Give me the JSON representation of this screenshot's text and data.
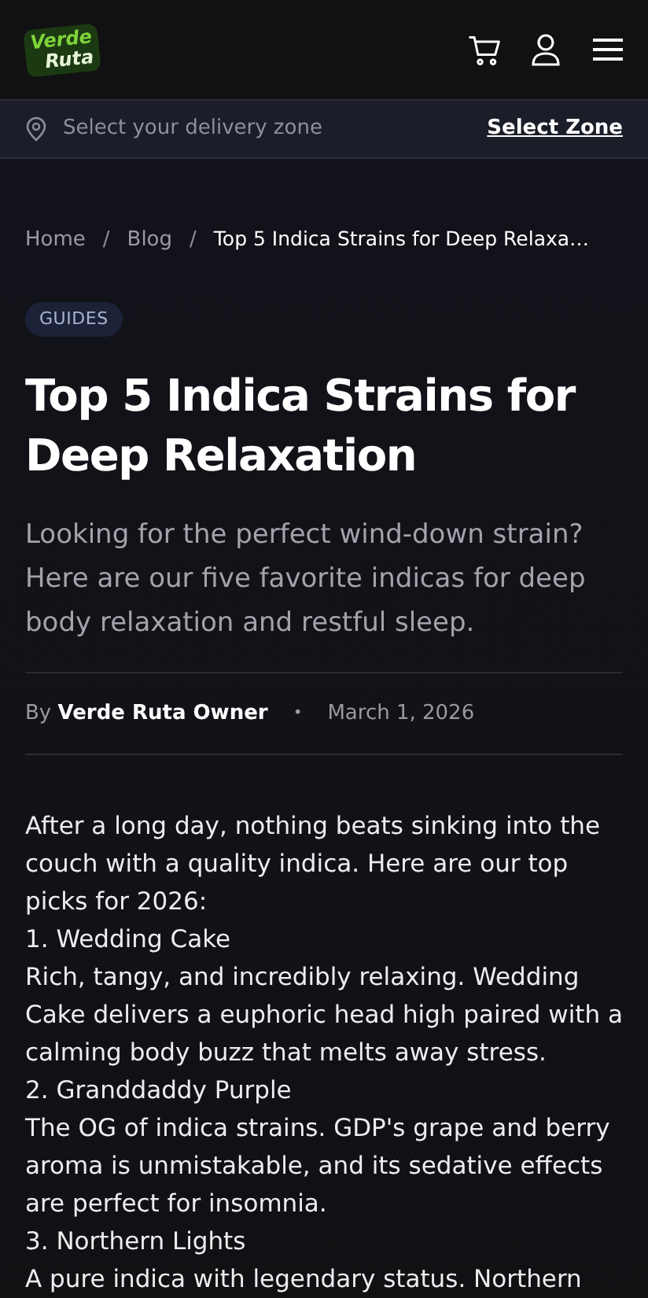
{
  "header": {
    "logo": [
      "Verde",
      "Ruta"
    ]
  },
  "zone_bar": {
    "prompt": "Select your delivery zone",
    "action": "Select Zone"
  },
  "breadcrumb": [
    {
      "label": "Home",
      "current": false
    },
    {
      "separator": "/",
      "label": "Blog",
      "current": false
    },
    {
      "separator": "/",
      "label": "Top 5 Indica Strains for Deep Relaxa…",
      "current": true
    }
  ],
  "article": {
    "category": "GUIDES",
    "title": "Top 5 Indica Strains for Deep Relaxation",
    "subtitle": "Looking for the perfect wind-down strain? Here are our five favorite indicas for deep body relaxation and restful sleep.",
    "byline_prefix": "By",
    "author": "Verde Ruta Owner",
    "separator": "•",
    "date": "March 1, 2026",
    "body": [
      "After a long day, nothing beats sinking into the couch with a quality indica. Here are our top picks for 2026:",
      "1. Wedding Cake",
      "Rich, tangy, and incredibly relaxing. Wedding Cake delivers a euphoric head high paired with a calming body buzz that melts away stress.",
      "2. Granddaddy Purple",
      "The OG of indica strains. GDP's grape and berry aroma is unmistakable, and its sedative effects are perfect for insomnia.",
      "3. Northern Lights",
      "A pure indica with legendary status. Northern"
    ]
  }
}
